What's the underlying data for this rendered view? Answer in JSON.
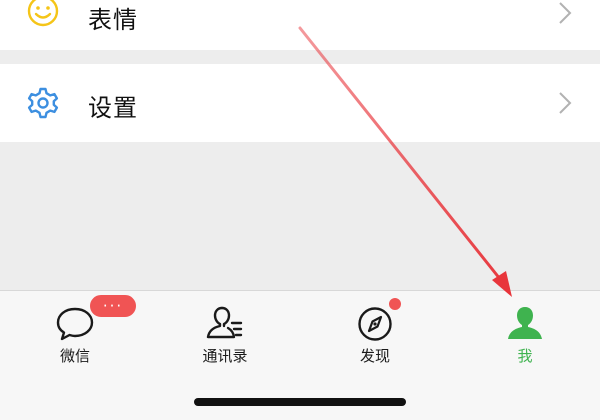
{
  "menu": {
    "emoji": {
      "label": "表情",
      "icon": "smiley-icon",
      "color": "#f5c518"
    },
    "settings": {
      "label": "设置",
      "icon": "gear-icon",
      "color": "#3d8fe0"
    }
  },
  "tabbar": {
    "tabs": [
      {
        "label": "微信",
        "icon": "chat-bubble-icon",
        "badge": "···"
      },
      {
        "label": "通讯录",
        "icon": "contacts-icon"
      },
      {
        "label": "发现",
        "icon": "compass-icon",
        "badge": "dot"
      },
      {
        "label": "我",
        "icon": "person-icon",
        "active": true
      }
    ]
  },
  "colors": {
    "accent": "#3fb34f",
    "badge": "#f05454",
    "arrow": "#e8353b"
  }
}
